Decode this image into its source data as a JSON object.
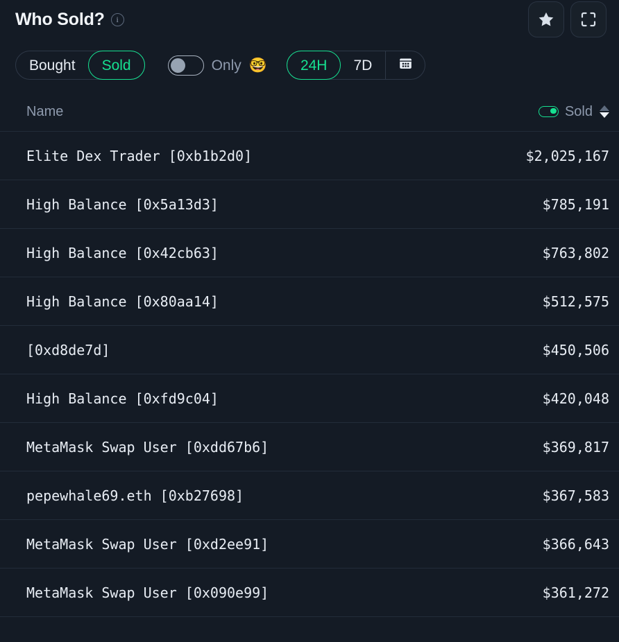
{
  "header": {
    "title": "Who Sold?",
    "info_icon": "info-icon",
    "info_glyph": "i",
    "favorite_icon": "star-icon",
    "expand_icon": "expand-icon"
  },
  "toolbar": {
    "side_filter": {
      "options": [
        "Bought",
        "Sold"
      ],
      "selected": "Sold"
    },
    "only_toggle": {
      "label": "Only",
      "emoji": "🤓",
      "state": "off"
    },
    "time_range": {
      "options": [
        "24H",
        "7D"
      ],
      "selected": "24H",
      "calendar_icon": "calendar-icon"
    }
  },
  "table": {
    "columns": {
      "name": "Name",
      "value": "Sold"
    },
    "value_toggle_state": "on",
    "sort": {
      "column": "Sold",
      "direction": "desc"
    },
    "rows": [
      {
        "name": "Elite Dex Trader [0xb1b2d0]",
        "value": "$2,025,167"
      },
      {
        "name": "High Balance [0x5a13d3]",
        "value": "$785,191"
      },
      {
        "name": "High Balance [0x42cb63]",
        "value": "$763,802"
      },
      {
        "name": "High Balance [0x80aa14]",
        "value": "$512,575"
      },
      {
        "name": "[0xd8de7d]",
        "value": "$450,506"
      },
      {
        "name": "High Balance [0xfd9c04]",
        "value": "$420,048"
      },
      {
        "name": "MetaMask Swap User [0xdd67b6]",
        "value": "$369,817"
      },
      {
        "name": "pepewhale69.eth [0xb27698]",
        "value": "$367,583"
      },
      {
        "name": "MetaMask Swap User [0xd2ee91]",
        "value": "$366,643"
      },
      {
        "name": "MetaMask Swap User [0x090e99]",
        "value": "$361,272"
      }
    ]
  },
  "colors": {
    "accent_green": "#16e191",
    "background": "#141b25",
    "row_border": "#222c39",
    "text_primary": "#e8edf4",
    "text_muted": "#8e9aad"
  }
}
